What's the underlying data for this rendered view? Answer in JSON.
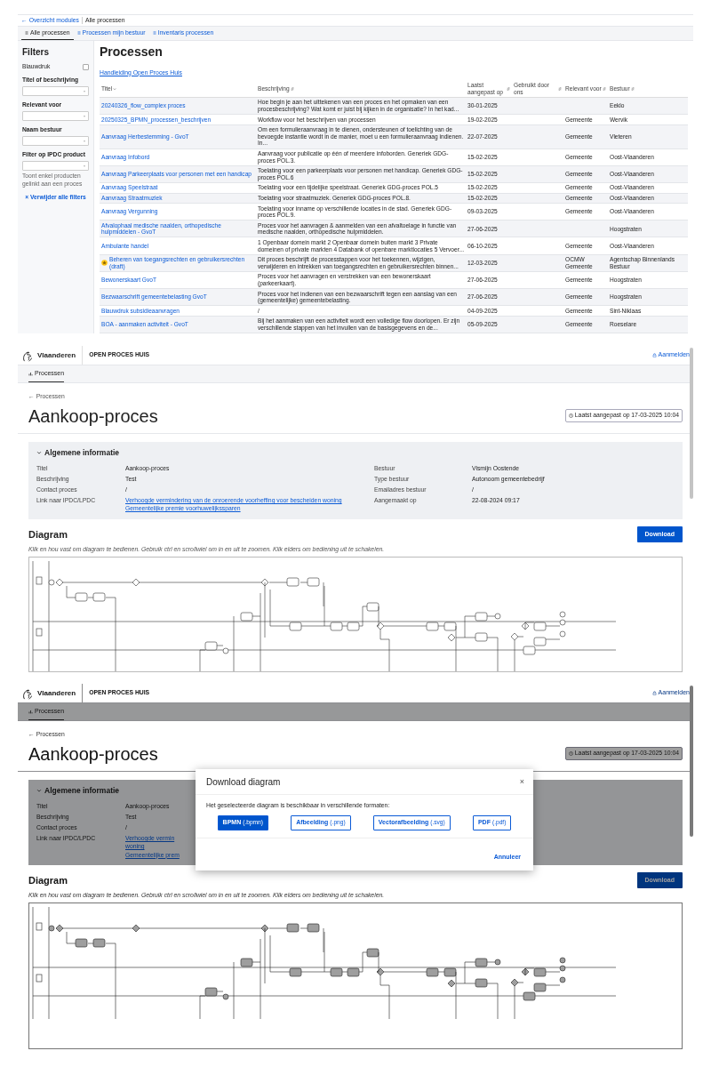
{
  "process_list": {
    "breadcrumb": [
      {
        "label": "← Overzicht modules",
        "kind": "link"
      },
      {
        "label": "Alle processen",
        "kind": "current"
      }
    ],
    "tabs": [
      {
        "label": "Alle processen",
        "selected": true
      },
      {
        "label": "Processen mijn bestuur",
        "selected": false
      },
      {
        "label": "Inventaris processen",
        "selected": false
      }
    ],
    "filters": {
      "title": "Filters",
      "checkbox": {
        "label": "Blauwdruk",
        "checked": false
      },
      "fields": [
        {
          "label": "Titel of beschrijving"
        },
        {
          "label": "Relevant voor"
        },
        {
          "label": "Naam bestuur"
        },
        {
          "label": "Filter op IPDC product",
          "hint": "Toont enkel producten gelinkt aan een proces"
        }
      ],
      "clear": "× Verwijder alle filters"
    },
    "title": "Processen",
    "manual_link": "Handleiding Open Proces Huis",
    "table": {
      "columns": [
        "Titel",
        "Beschrijving",
        "Laatst aangepast op",
        "Gebruikt door ons",
        "Relevant voor",
        "Bestuur"
      ],
      "rows": [
        {
          "title": "20240326_flow_complex proces",
          "starred": false,
          "description": "Hoe begin je aan het uittekenen van een proces en het opmaken van een procesbeschrijving? Wat komt er juist bij kijken in de organisatie? In het kad...",
          "updated": "30-01-2025",
          "relevant_for": [],
          "bestuur": "Eeklo"
        },
        {
          "title": "20250325_BPMN_processen_beschrijven",
          "starred": false,
          "description": "Workflow voor het beschrijven van processen",
          "updated": "19-02-2025",
          "relevant_for": [
            "Gemeente"
          ],
          "bestuur": "Wervik"
        },
        {
          "title": "Aanvraag Herbestemming - GvoT",
          "starred": false,
          "description": "Om een formulieraanvraag in te dienen, ondersteunen of toelichting van de bevoegde instantie wordt in de manier, moet u een formulieraanvraag indienen. In...",
          "updated": "22-07-2025",
          "relevant_for": [
            "Gemeente"
          ],
          "bestuur": "Vleteren"
        },
        {
          "title": "Aanvraag Infobord",
          "starred": false,
          "description": "Aanvraag voor publicatie op één of meerdere infoborden. Generiek GDG-proces POL.3.",
          "updated": "15-02-2025",
          "relevant_for": [
            "Gemeente"
          ],
          "bestuur": "Oost-Vlaanderen"
        },
        {
          "title": "Aanvraag Parkeerplaats voor personen met een handicap",
          "starred": false,
          "description": "Toelating voor een parkeerplaats voor personen met handicap. Generiek GDG-proces POL.6",
          "updated": "15-02-2025",
          "relevant_for": [
            "Gemeente"
          ],
          "bestuur": "Oost-Vlaanderen"
        },
        {
          "title": "Aanvraag Speelstraat",
          "starred": false,
          "description": "Toelating voor een tijdelijke speelstraat. Generiek GDG-proces POL.5",
          "updated": "15-02-2025",
          "relevant_for": [
            "Gemeente"
          ],
          "bestuur": "Oost-Vlaanderen"
        },
        {
          "title": "Aanvraag Straatmuziek",
          "starred": false,
          "description": "Toelating voor straatmuziek. Generiek GDG-proces POL.8.",
          "updated": "15-02-2025",
          "relevant_for": [
            "Gemeente"
          ],
          "bestuur": "Oost-Vlaanderen"
        },
        {
          "title": "Aanvraag Vergunning",
          "starred": false,
          "description": "Toelating voor inname op verschillende locaties in de stad. Generiek GDG-proces POL.9.",
          "updated": "09-03-2025",
          "relevant_for": [
            "Gemeente"
          ],
          "bestuur": "Oost-Vlaanderen"
        },
        {
          "title": "Afvalophaal medische naalden, orthopedische hulpmiddelen - GvoT",
          "starred": false,
          "description": "Proces voor het aanvragen & aanmelden van een afvaltoelage in functie van medische naalden, orthopedische hulpmiddelen.",
          "updated": "27-06-2025",
          "relevant_for": [],
          "bestuur": "Hoogstraten"
        },
        {
          "title": "Ambulante handel",
          "starred": false,
          "description": "1 Openbaar domein markt 2 Openbaar domein buiten markt 3 Private domeinen of private markten 4 Databank of openbare marktlocaties 5 Vervoer...",
          "updated": "06-10-2025",
          "relevant_for": [
            "Gemeente"
          ],
          "bestuur": "Oost-Vlaanderen"
        },
        {
          "title": "Beheren van toegangsrechten en gebruikersrechten (draft)",
          "starred": true,
          "description": "Dit proces beschrijft de processtappen voor het toekennen, wijzigen, verwijderen en intrekken van toegangsrechten en gebruikersrechten binnen...",
          "updated": "12-03-2025",
          "relevant_for": [
            "OCMW",
            "Gemeente"
          ],
          "bestuur": "Agentschap Binnenlands Bestuur"
        },
        {
          "title": "Bewonerskaart GvoT",
          "starred": false,
          "description": "Proces voor het aanvragen en verstrekken van een bewonerskaart (parkeerkaart).",
          "updated": "27-06-2025",
          "relevant_for": [
            "Gemeente"
          ],
          "bestuur": "Hoogstraten"
        },
        {
          "title": "Bezwaarschrift gemeentebelasting GvoT",
          "starred": false,
          "description": "Proces voor het indienen van een bezwaarschrift tegen een aanslag van een (gemeentelijke) gemeentebelasting.",
          "updated": "27-06-2025",
          "relevant_for": [
            "Gemeente"
          ],
          "bestuur": "Hoogstraten"
        },
        {
          "title": "Blauwdruk subsidieaanvragen",
          "starred": false,
          "description": "/",
          "updated": "04-09-2025",
          "relevant_for": [
            "Gemeente"
          ],
          "bestuur": "Sint-Niklaas"
        },
        {
          "title": "BOA - aanmaken activiteit - GvoT",
          "starred": false,
          "description": "Bij het aanmaken van een activiteit wordt een volledige flow doorlopen. Er zijn verschillende stappen van het invullen van de basisgegevens en de...",
          "updated": "05-09-2025",
          "relevant_for": [
            "Gemeente"
          ],
          "bestuur": "Roeselare"
        }
      ]
    }
  },
  "process_detail": {
    "header": {
      "brand": "Vlaanderen",
      "site": "OPEN PROCES HUIS",
      "login": "Aanmelden"
    },
    "tabs": [
      {
        "label": "Processen",
        "selected": true
      }
    ],
    "back": "← Processen",
    "title": "Aankoop-proces",
    "updated": "Laatst aangepast op 17-03-2025 10:04",
    "info": {
      "title": "Algemene informatie",
      "expanded": true,
      "left": [
        {
          "label": "Titel",
          "value": "Aankoop-proces"
        },
        {
          "label": "Beschrijving",
          "value": "Test"
        },
        {
          "label": "Contact proces",
          "value": "/"
        },
        {
          "label": "Link naar IPDC/LPDC",
          "links": [
            "Verhoogde vermindering van de onroerende voorheffing voor bescheiden woning",
            "Gemeentelijke premie voorhuwelijkssparen"
          ]
        }
      ],
      "right": [
        {
          "label": "Bestuur",
          "value": "Vismijn Oostende"
        },
        {
          "label": "Type bestuur",
          "value": "Autonoom gemeentebedrijf"
        },
        {
          "label": "Emailadres bestuur",
          "value": "/"
        },
        {
          "label": "Aangemaakt op",
          "value": "22-08-2024 09:17"
        }
      ]
    },
    "diagram": {
      "title": "Diagram",
      "download": "Download",
      "hint": "Klik en hou vast om diagram te bedienen. Gebruik ctrl en scrollwiel om in en uit te zoomen. Klik elders om bediening uit te schakelen."
    }
  },
  "process_detail_dialog": {
    "header": {
      "brand": "Vlaanderen",
      "site": "OPEN PROCES HUIS",
      "login": "Aanmelden"
    },
    "tabs": [
      {
        "label": "Processen",
        "selected": true
      }
    ],
    "back": "← Processen",
    "title": "Aankoop-proces",
    "updated": "Laatst aangepast op 17-03-2025 10:04",
    "info": {
      "title": "Algemene informatie",
      "expanded": true,
      "left": [
        {
          "label": "Titel",
          "value": "Aankoop-proces"
        },
        {
          "label": "Beschrijving",
          "value": "Test"
        },
        {
          "label": "Contact proces",
          "value": "/"
        },
        {
          "label": "Link naar IPDC/LPDC",
          "links": [
            "Verhoogde vermin",
            "woning",
            "Gemeentelijke prem"
          ]
        }
      ]
    },
    "diagram": {
      "title": "Diagram",
      "download": "Download",
      "hint": "Klik en hou vast om diagram te bedienen. Gebruik ctrl en scrollwiel om in en uit te zoomen. Klik elders om bediening uit te schakelen."
    },
    "dialog": {
      "title": "Download diagram",
      "close": "×",
      "text": "Het geselecteerde diagram is beschikbaar in verschillende formaten:",
      "formats": [
        {
          "label": "BPMN",
          "ext": "(.bpmn)",
          "selected": true
        },
        {
          "label": "Afbeelding",
          "ext": "(.png)",
          "selected": false
        },
        {
          "label": "Vectorafbeelding",
          "ext": "(.svg)",
          "selected": false
        },
        {
          "label": "PDF",
          "ext": "(.pdf)",
          "selected": false
        }
      ],
      "cancel": "Annuleer"
    }
  }
}
